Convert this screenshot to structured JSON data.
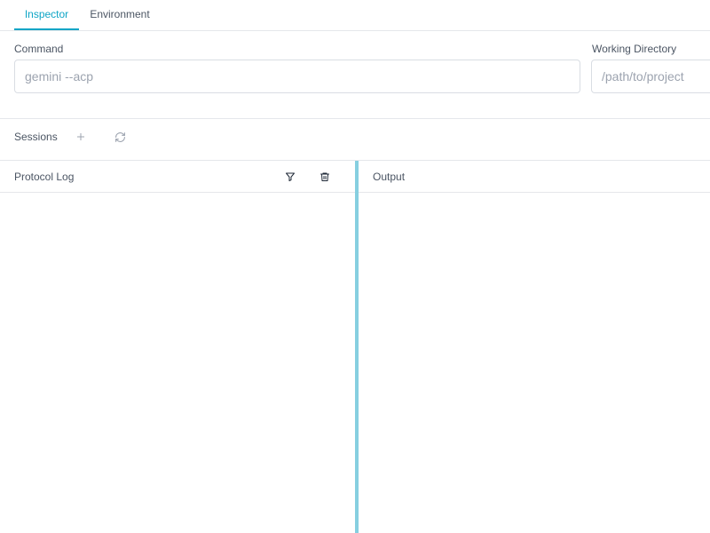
{
  "tabs": [
    {
      "label": "Inspector",
      "active": true
    },
    {
      "label": "Environment",
      "active": false
    }
  ],
  "command": {
    "label": "Command",
    "value": "",
    "placeholder": "gemini --acp"
  },
  "working_directory": {
    "label": "Working Directory",
    "value": "",
    "placeholder": "/path/to/project"
  },
  "sessions": {
    "label": "Sessions",
    "add_icon": "plus-icon",
    "refresh_icon": "refresh-icon"
  },
  "protocol_log": {
    "title": "Protocol Log",
    "filter_icon": "filter-icon",
    "clear_icon": "trash-icon"
  },
  "output": {
    "title": "Output"
  },
  "colors": {
    "accent": "#0ea5c6",
    "divider": "#86cfe0",
    "border": "#e5e7eb",
    "text": "#4b5563",
    "placeholder": "#9ca3af"
  }
}
